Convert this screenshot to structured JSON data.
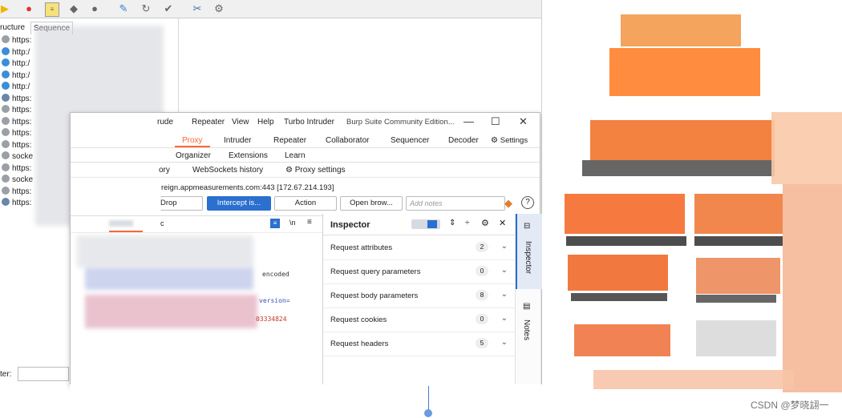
{
  "bg_app": {
    "tabs": [
      "ructure",
      "Sequence"
    ],
    "tree_items": [
      {
        "text": "https:",
        "icon": "lock-icon",
        "color": "#9aa0a6"
      },
      {
        "text": "http:/",
        "icon": "globe-icon",
        "color": "#3b8ed8"
      },
      {
        "text": "http:/",
        "icon": "globe-icon",
        "color": "#3b8ed8"
      },
      {
        "text": "http:/",
        "icon": "globe-icon",
        "color": "#3b8ed8"
      },
      {
        "text": "http:/",
        "icon": "globe-icon",
        "color": "#3b8ed8"
      },
      {
        "text": "https:",
        "icon": "gear-icon",
        "color": "#6b86a8"
      },
      {
        "text": "https:",
        "icon": "lock-icon",
        "color": "#9aa0a6"
      },
      {
        "text": "https:",
        "icon": "lock-icon",
        "color": "#9aa0a6"
      },
      {
        "text": "https:",
        "icon": "lock-icon",
        "color": "#9aa0a6"
      },
      {
        "text": "https:",
        "icon": "lock-icon",
        "color": "#9aa0a6"
      },
      {
        "text": "socke",
        "icon": "socket-icon",
        "color": "#9aa0a6"
      },
      {
        "text": "https:",
        "icon": "lock-icon",
        "color": "#9aa0a6"
      },
      {
        "text": "socke",
        "icon": "socket-icon",
        "color": "#9aa0a6"
      },
      {
        "text": "https:",
        "icon": "lock-icon",
        "color": "#9aa0a6"
      },
      {
        "text": "https:",
        "icon": "gear-icon",
        "color": "#6b86a8"
      }
    ],
    "filter_label": "ter:"
  },
  "burp": {
    "menus": [
      "rude",
      "Repeater",
      "View",
      "Help",
      "Turbo Intruder"
    ],
    "title": "Burp Suite Community Edition...",
    "tabs1": [
      "Proxy",
      "Intruder",
      "Repeater",
      "Collaborator",
      "Sequencer",
      "Decoder",
      "Settings"
    ],
    "tabs1b": [
      "Organizer",
      "Extensions",
      "Learn"
    ],
    "tabs2": [
      "ory",
      "WebSockets history",
      "Proxy settings"
    ],
    "request_host": "reign.appmeasurements.com:443  [172.67.214.193]",
    "buttons": {
      "drop": "Drop",
      "intercept": "Intercept is...",
      "action": "Action",
      "open_browser": "Open brow...",
      "notes_placeholder": "Add notes"
    },
    "editor_tab": "c",
    "code": {
      "line1": "encoded",
      "line2": "version=",
      "line3": "03334824"
    },
    "inspector": {
      "title": "Inspector",
      "rows": [
        {
          "label": "Request attributes",
          "count": "2"
        },
        {
          "label": "Request query parameters",
          "count": "0"
        },
        {
          "label": "Request body parameters",
          "count": "8"
        },
        {
          "label": "Request cookies",
          "count": "0"
        },
        {
          "label": "Request headers",
          "count": "5"
        }
      ]
    },
    "sidebar": {
      "inspector": "Inspector",
      "notes": "Notes"
    },
    "accent": "#ff6633",
    "blue": "#2b6fcf"
  },
  "watermark": "CSDN @梦晓翃一"
}
